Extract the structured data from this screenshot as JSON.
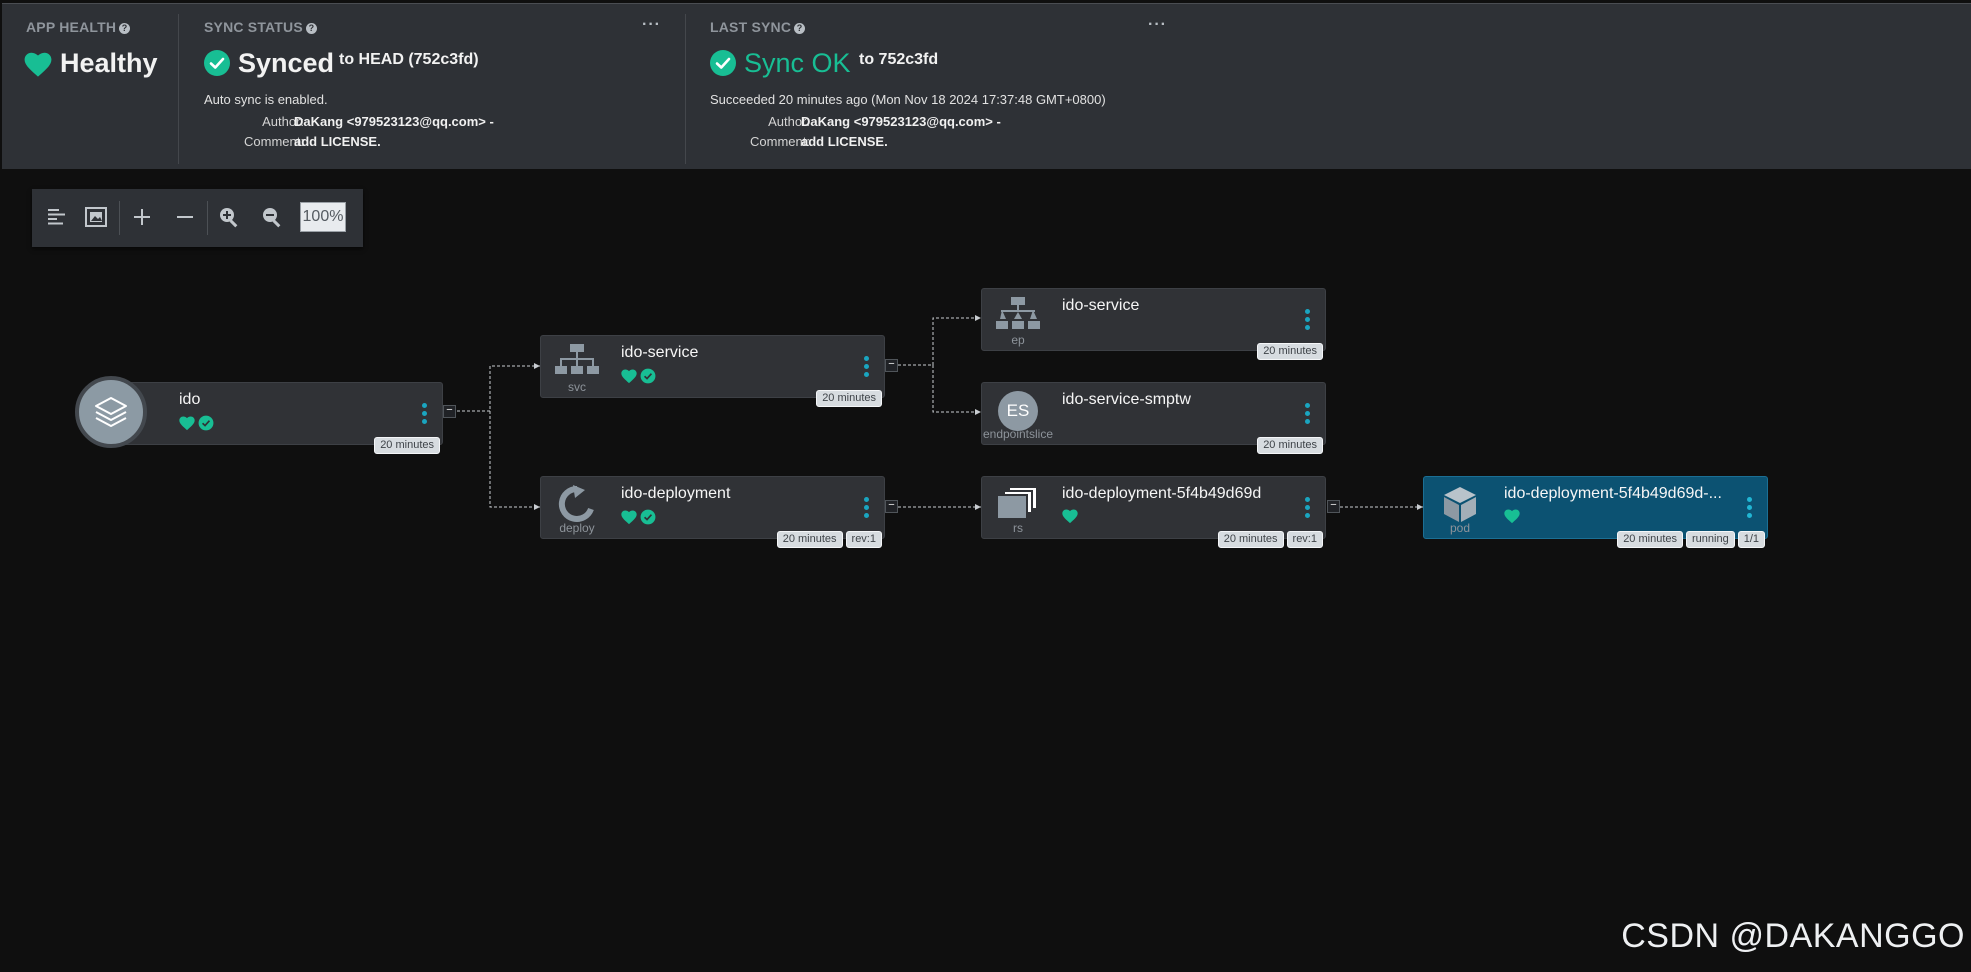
{
  "header": {
    "app_health": {
      "title": "APP HEALTH",
      "status": "Healthy",
      "color": "#18be94"
    },
    "sync_status": {
      "title": "SYNC STATUS",
      "status": "Synced",
      "target": "to HEAD (752c3fd)",
      "auto_sync": "Auto sync is enabled.",
      "author_label": "Author:",
      "author": "DaKang <979523123@qq.com> -",
      "comment_label": "Comment:",
      "comment": "add LICENSE."
    },
    "last_sync": {
      "title": "LAST SYNC",
      "status": "Sync OK",
      "target": "to 752c3fd",
      "succeeded": "Succeeded 20 minutes ago (Mon Nov 18 2024 17:37:48 GMT+0800)",
      "author_label": "Author:",
      "author": "DaKang <979523123@qq.com> -",
      "comment_label": "Comment:",
      "comment": "add LICENSE.",
      "color": "#18be94"
    },
    "more_label": "···"
  },
  "toolbar": {
    "zoom": "100%"
  },
  "graph": {
    "app": {
      "name": "ido",
      "age": "20 minutes"
    },
    "nodes": {
      "svc": {
        "name": "ido-service",
        "kind": "svc",
        "age": "20 minutes"
      },
      "deploy": {
        "name": "ido-deployment",
        "kind": "deploy",
        "age": "20 minutes",
        "rev": "rev:1"
      },
      "ep": {
        "name": "ido-service",
        "kind": "ep",
        "age": "20 minutes"
      },
      "es": {
        "name": "ido-service-smptw",
        "kind": "endpointslice",
        "icon_text": "ES",
        "age": "20 minutes"
      },
      "rs": {
        "name": "ido-deployment-5f4b49d69d",
        "kind": "rs",
        "age": "20 minutes",
        "rev": "rev:1"
      },
      "pod": {
        "name": "ido-deployment-5f4b49d69d-...",
        "kind": "pod",
        "age": "20 minutes",
        "status": "running",
        "ready": "1/1"
      }
    },
    "collapse_symbol": "−"
  },
  "watermark": "CSDN @DAKANGGO",
  "colors": {
    "healthy": "#18be94",
    "accent": "#1aa5c0",
    "selected_node": "#0c5272"
  }
}
